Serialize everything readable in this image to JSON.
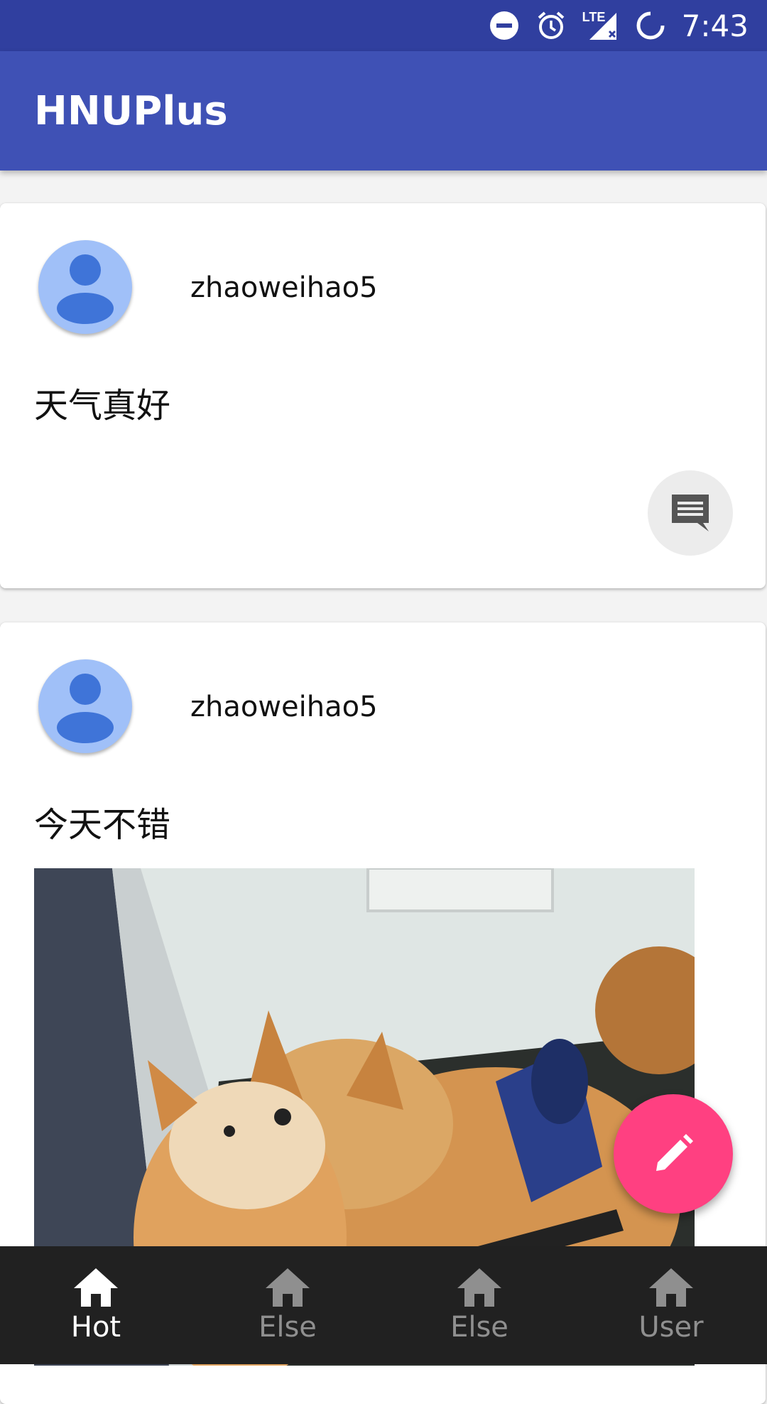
{
  "status_bar": {
    "time": "7:43",
    "icons": [
      "do-not-disturb-icon",
      "alarm-icon",
      "lte-signal-icon",
      "battery-charging-icon"
    ],
    "network_label": "LTE"
  },
  "app_bar": {
    "title": "HNUPlus"
  },
  "posts": [
    {
      "username": "zhaoweihao5",
      "text": "天气真好",
      "has_image": false
    },
    {
      "username": "zhaoweihao5",
      "text": "今天不错",
      "has_image": true
    }
  ],
  "bottom_nav": {
    "items": [
      {
        "label": "Hot",
        "icon": "home-icon",
        "active": true
      },
      {
        "label": "Else",
        "icon": "home-icon",
        "active": false
      },
      {
        "label": "Else",
        "icon": "home-icon",
        "active": false
      },
      {
        "label": "User",
        "icon": "home-icon",
        "active": false
      }
    ]
  },
  "colors": {
    "status_bar": "#303f9f",
    "app_bar": "#3f51b5",
    "fab": "#ff4081",
    "bottom_nav": "#212121",
    "avatar": "#a0c0f8",
    "avatar_figure": "#3f74d8"
  }
}
